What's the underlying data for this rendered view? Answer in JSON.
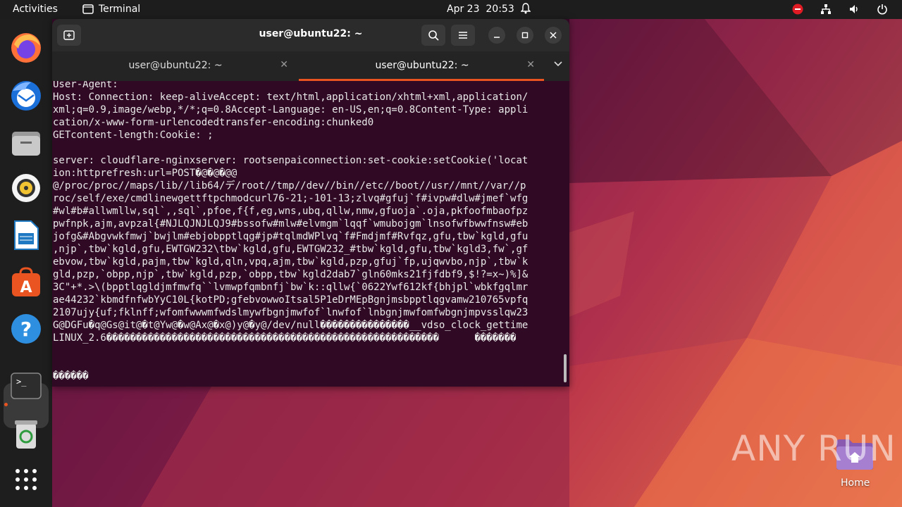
{
  "topbar": {
    "activities": "Activities",
    "app_name": "Terminal",
    "date": "Apr 23",
    "time": "20:53"
  },
  "dock": {
    "items": [
      "firefox-icon",
      "thunderbird-icon",
      "files-icon",
      "rhythmbox-icon",
      "writer-icon",
      "app-center-icon",
      "help-icon",
      "terminal-icon",
      "trash-icon",
      "show-apps-icon"
    ]
  },
  "window": {
    "title": "user@ubuntu22: ~",
    "tabs": [
      {
        "label": "user@ubuntu22: ~",
        "active": false
      },
      {
        "label": "user@ubuntu22: ~",
        "active": true
      }
    ],
    "accent": "#e95420",
    "background": "#300a24"
  },
  "terminal": {
    "lines": [
      "User-Agent:",
      "Host: Connection: keep-aliveAccept: text/html,application/xhtml+xml,application/",
      "xml;q=0.9,image/webp,*/*;q=0.8Accept-Language: en-US,en;q=0.8Content-Type: appli",
      "cation/x-www-form-urlencodedtransfer-encoding:chunked0",
      "GETcontent-length:Cookie: ;",
      "",
      "server: cloudflare-nginxserver: rootsenpaiconnection:set-cookie:setCookie('locat",
      "ion:httprefresh:url=POST�@�@�@@",
      "@/proc/proc//maps/lib//lib64/デ/root//tmp//dev//bin//etc//boot//usr//mnt//var//p",
      "roc/self/exe/cmdlinewgettftpchmodcurl76-21;-101-13;zlvq#gfuj`f#ivpw#dlw#jmef`wfg",
      "#wl#b#allwmllw,sql`,,sql`,pfoe,f{f,eg,wns,ubq,qllw,nmw,gfuoja`.oja,pkfoofmbaofpz",
      "pwfnpk,ajm,avpzal{#NJLQJNJLQJ9#bssofw#mlw#elvmgm`lqqf`wmubojgm`lnsofwfbwwfnsw#eb",
      "jofg&#Abgvwkfmwj`bwjlm#ebjobpptlqg#jp#tqlmdWPlvq`f#Fmdjmf#Rvfqz,gfu,tbw`kgld,gfu",
      ",njp`,tbw`kgld,gfu,EWTGW232\\tbw`kgld,gfu,EWTGW232_#tbw`kgld,gfu,tbw`kgld3,fw`,gf",
      "ebvow,tbw`kgld,pajm,tbw`kgld,qln,vpq,ajm,tbw`kgld,pzp,gfuj`fp,ujqwvbo,njp`,tbw`k",
      "gld,pzp,`obpp,njp`,tbw`kgld,pzp,`obpp,tbw`kgld2dab7`gln60mks21fjfdbf9,$!?=x~)%]&",
      "3C\"+*.>\\(bpptlqgldjmfmwfq``lvmwpfqmbnfj`bw`k::qllw{`0622Ywf612kf{bhjpl`wbkfgqlmr",
      "ae44232`kbmdfnfwbYyC10L{kotPD;gfebvowwoItsal5P1eDrMEpBgnjmsbpptlqgvamw210765vpfq",
      "2107ujy{uf;fklnff;wfomfwwwmfwdslmywfbgnjmwfof`lnwfof`lnbgnjmwfomfwbgnjmpvsslqw23",
      "G@DGFu�q@Gs@it@�t@Yw@�w@Ax@�x@)y@�y@/dev/null���������������__vdso_clock_gettime",
      "LINUX_2.6��������������������������������������������������������      �������",
      "",
      "",
      "������"
    ]
  },
  "desktop": {
    "home_label": "Home",
    "watermark": "ANY RUN"
  }
}
